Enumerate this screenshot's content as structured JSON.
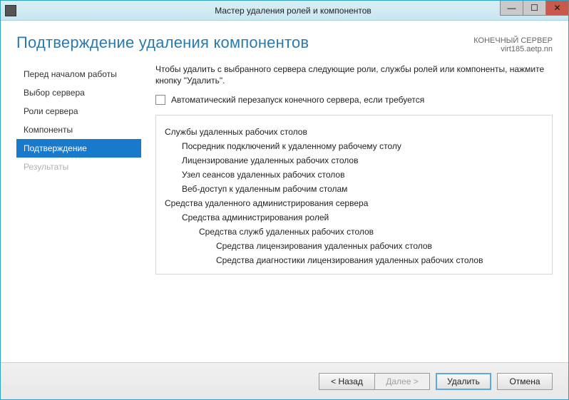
{
  "title": "Мастер удаления ролей и компонентов",
  "header": {
    "page_title": "Подтверждение удаления компонентов",
    "server_label": "КОНЕЧНЫЙ СЕРВЕР",
    "server_name": "virt185.aetp.nn"
  },
  "sidebar": {
    "items": [
      {
        "label": "Перед началом работы",
        "state": "normal"
      },
      {
        "label": "Выбор сервера",
        "state": "normal"
      },
      {
        "label": "Роли сервера",
        "state": "normal"
      },
      {
        "label": "Компоненты",
        "state": "normal"
      },
      {
        "label": "Подтверждение",
        "state": "active"
      },
      {
        "label": "Результаты",
        "state": "disabled"
      }
    ]
  },
  "main": {
    "instruction": "Чтобы удалить с выбранного сервера следующие роли, службы ролей или компоненты, нажмите кнопку \"Удалить\".",
    "restart_checkbox_label": "Автоматический перезапуск конечного сервера, если требуется",
    "features": {
      "group1": {
        "title": "Службы удаленных рабочих столов",
        "items": [
          "Посредник подключений к удаленному рабочему столу",
          "Лицензирование удаленных рабочих столов",
          "Узел сеансов удаленных рабочих столов",
          "Веб-доступ к удаленным рабочим столам"
        ]
      },
      "group2": {
        "title": "Средства удаленного администрирования сервера",
        "sub1": {
          "title": "Средства администрирования ролей",
          "sub2": {
            "title": "Средства служб удаленных рабочих столов",
            "items": [
              "Средства лицензирования удаленных рабочих столов",
              "Средства диагностики лицензирования удаленных рабочих столов"
            ]
          }
        }
      }
    }
  },
  "footer": {
    "back": "< Назад",
    "next": "Далее >",
    "remove": "Удалить",
    "cancel": "Отмена"
  }
}
